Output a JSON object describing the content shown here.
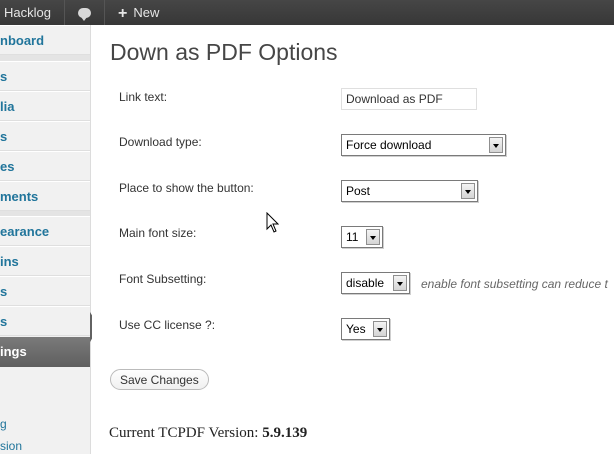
{
  "adminbar": {
    "site_name": "Hacklog",
    "new_label": "New"
  },
  "sidebar": {
    "items": [
      {
        "label": "nboard"
      },
      {
        "label": "s"
      },
      {
        "label": "lia"
      },
      {
        "label": "s"
      },
      {
        "label": "es"
      },
      {
        "label": "ments"
      },
      {
        "label": "earance"
      },
      {
        "label": "ins"
      },
      {
        "label": "s"
      },
      {
        "label": "s"
      },
      {
        "label": "ings"
      }
    ],
    "sub_items": [
      {
        "label": "g"
      },
      {
        "label": "sion"
      }
    ]
  },
  "page": {
    "title": "Down as PDF Options",
    "fields": [
      {
        "label": "Link text:",
        "value": "Download as PDF"
      },
      {
        "label": "Download type:",
        "value": "Force download"
      },
      {
        "label": "Place to show the button:",
        "value": "Post"
      },
      {
        "label": "Main font size:",
        "value": "11"
      },
      {
        "label": "Font Subsetting:",
        "value": "disable"
      },
      {
        "label": "Use CC license ?:",
        "value": "Yes"
      }
    ],
    "subsetting_hint": "enable font subsetting can reduce t",
    "save_label": "Save Changes",
    "version_label": "Current TCPDF Version:",
    "version_number": "5.9.139"
  }
}
